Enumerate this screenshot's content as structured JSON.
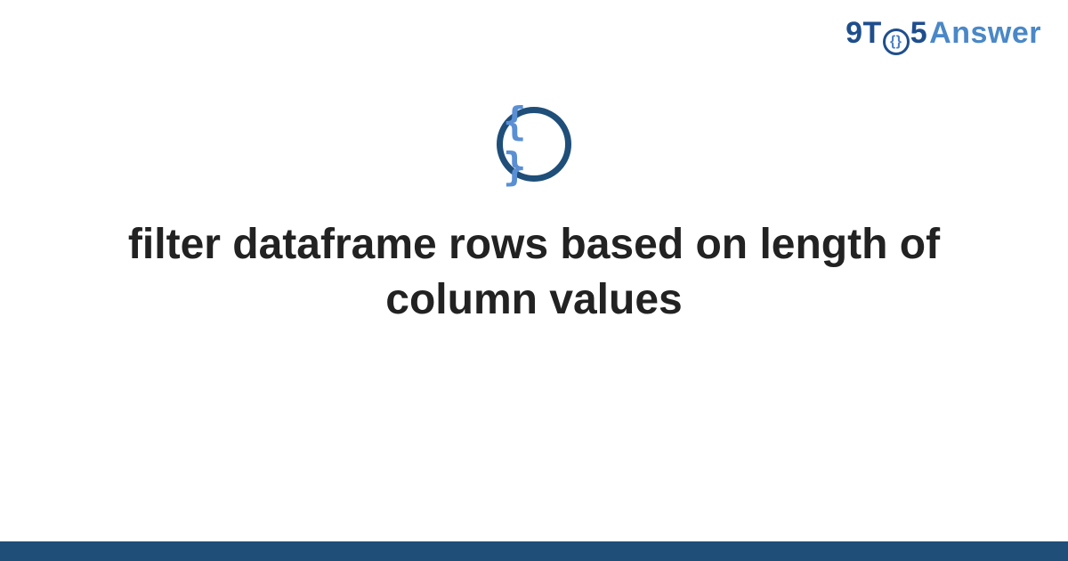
{
  "logo": {
    "part1": "9T",
    "circle_inner": "{}",
    "part2": "5",
    "part3": "Answer"
  },
  "badge": {
    "glyph": "{ }"
  },
  "title": "filter dataframe rows based on length of column values"
}
